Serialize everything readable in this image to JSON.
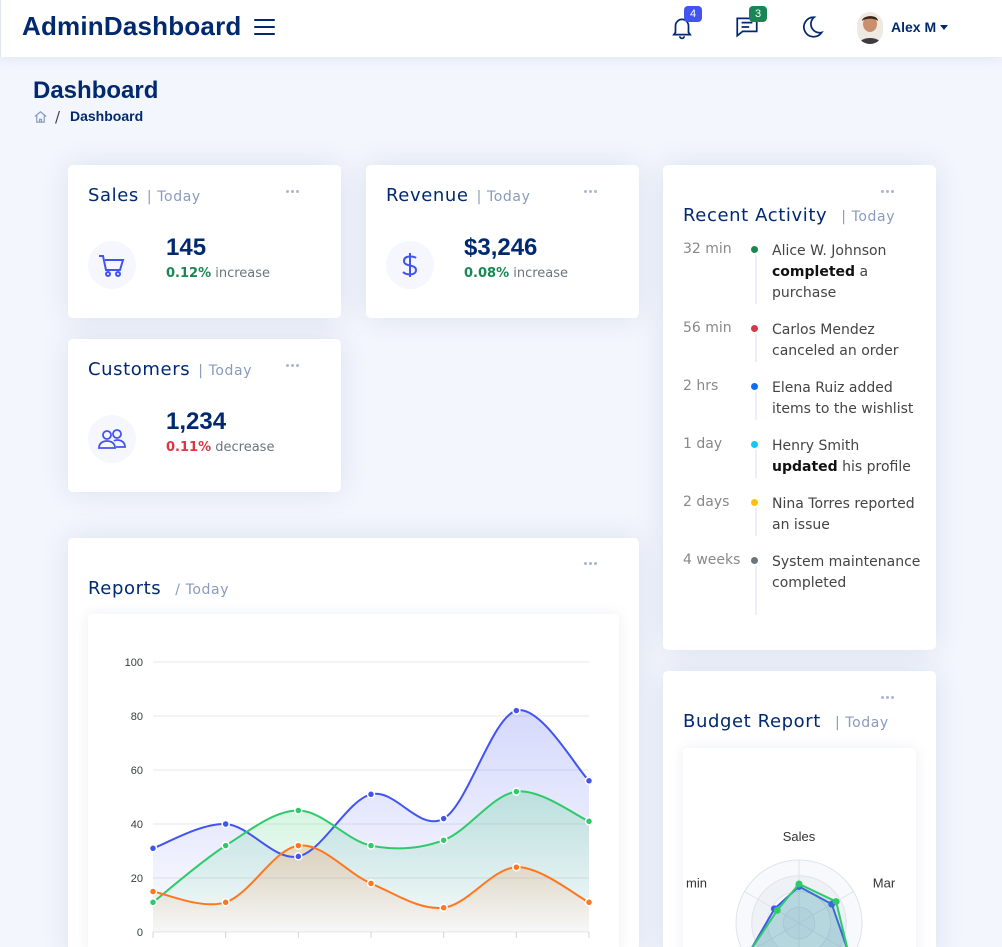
{
  "header": {
    "brand": "AdminDashboard",
    "notifications_count": "4",
    "messages_count": "3",
    "user_name": "Alex M"
  },
  "page": {
    "title": "Dashboard",
    "breadcrumb": "Dashboard"
  },
  "cards": {
    "sales": {
      "title": "Sales",
      "filter": "| Today",
      "value": "145",
      "pct": "0.12%",
      "trend": "increase",
      "icon": "cart-icon"
    },
    "revenue": {
      "title": "Revenue",
      "filter": "| Today",
      "value": "$3,246",
      "pct": "0.08%",
      "trend": "increase",
      "icon": "dollar-icon"
    },
    "customers": {
      "title": "Customers",
      "filter": "| Today",
      "value": "1,234",
      "pct": "0.11%",
      "trend": "decrease",
      "icon": "people-icon"
    }
  },
  "activity": {
    "title": "Recent Activity",
    "filter": "| Today",
    "items": [
      {
        "time": "32 min",
        "color": "#198754",
        "before": "Alice W. Johnson ",
        "bold": "completed",
        "after": " a purchase"
      },
      {
        "time": "56 min",
        "color": "#dc3545",
        "before": "Carlos Mendez canceled an order",
        "bold": "",
        "after": ""
      },
      {
        "time": "2 hrs",
        "color": "#0d6efd",
        "before": "Elena Ruiz added items to the wishlist",
        "bold": "",
        "after": ""
      },
      {
        "time": "1 day",
        "color": "#0dcaf0",
        "before": "Henry Smith ",
        "bold": "updated",
        "after": " his profile"
      },
      {
        "time": "2 days",
        "color": "#ffc107",
        "before": "Nina Torres reported an issue",
        "bold": "",
        "after": ""
      },
      {
        "time": "4 weeks",
        "color": "#6c757d",
        "before": "System maintenance completed",
        "bold": "",
        "after": ""
      }
    ]
  },
  "reports": {
    "title": "Reports",
    "filter": "/ Today"
  },
  "budget": {
    "title": "Budget Report",
    "filter": "| Today"
  },
  "chart_data": [
    {
      "type": "area",
      "ylim": [
        0,
        100
      ],
      "y_ticks": [
        "100",
        "80",
        "60",
        "40",
        "20",
        "0"
      ],
      "x": [
        0,
        1,
        2,
        3,
        4,
        5,
        6
      ],
      "series": [
        {
          "color": "#4154f1",
          "values": [
            31,
            40,
            28,
            51,
            42,
            82,
            56
          ]
        },
        {
          "color": "#2eca6a",
          "values": [
            11,
            32,
            45,
            32,
            34,
            52,
            41
          ]
        },
        {
          "color": "#ff771d",
          "values": [
            15,
            11,
            32,
            18,
            9,
            24,
            11
          ]
        }
      ],
      "grid": true
    },
    {
      "type": "radar",
      "axes_visible": [
        "Sales",
        "Mar",
        "min"
      ],
      "series": [
        {
          "color": "#4154f1",
          "values": [
            0.58,
            0.6,
            0.45
          ]
        },
        {
          "color": "#2eca6a",
          "values": [
            0.62,
            0.68,
            0.4
          ]
        }
      ]
    }
  ],
  "colors": {
    "brand": "#012970",
    "primary": "#4154f1",
    "success": "#198754",
    "danger": "#dc3545"
  }
}
